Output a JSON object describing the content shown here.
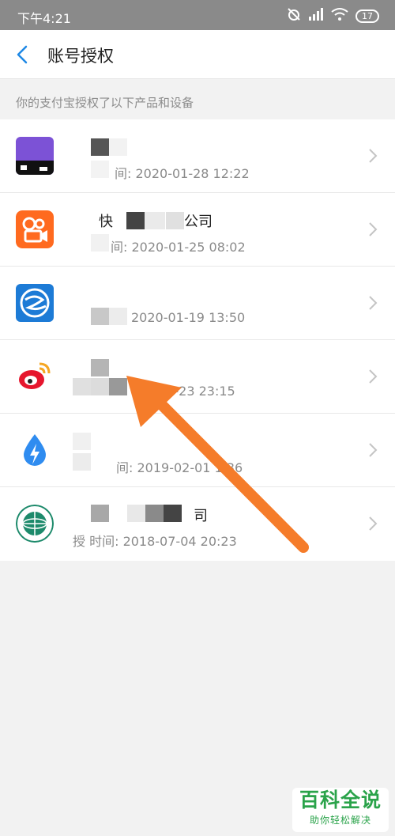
{
  "status_bar": {
    "time": "下午4:21",
    "battery": "17"
  },
  "nav": {
    "title": "账号授权"
  },
  "caption": "你的支付宝授权了以下产品和设备",
  "items": [
    {
      "name": "",
      "time": "间: 2020-01-28 12:22",
      "icon": "purple-app-icon",
      "color": "#7c52d6"
    },
    {
      "name": "快　　　　　公司",
      "time": "间: 2020-01-25 08:02",
      "icon": "kuaishou-icon",
      "color": "#ff6a1f"
    },
    {
      "name": "",
      "time": "2020-01-19 13:50",
      "icon": "blue-swirl-icon",
      "color": "#1d7bd6"
    },
    {
      "name": "",
      "time": "12-23 23:15",
      "icon": "weibo-icon",
      "color": "#e6162d"
    },
    {
      "name": "",
      "time": "间: 2019-02-01 1 36",
      "icon": "water-drop-icon",
      "color": "#2f8cf0"
    },
    {
      "name": "司",
      "time": "授 时间: 2018-07-04 20:23",
      "icon": "state-grid-icon",
      "color": "#1d8a6b"
    }
  ],
  "watermark": {
    "title": "百科全说",
    "subtitle": "助你轻松解决"
  }
}
